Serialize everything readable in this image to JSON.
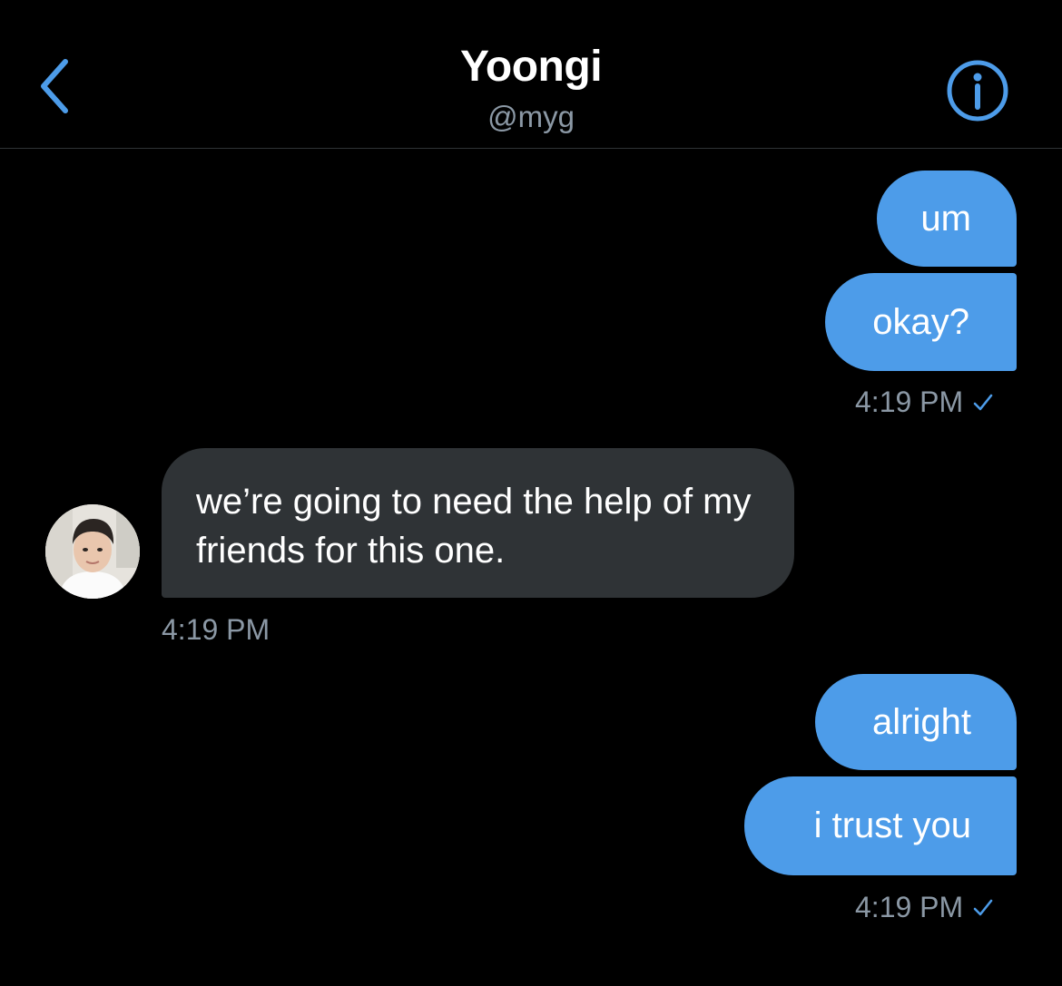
{
  "header": {
    "title": "Yoongi",
    "handle": "@myg",
    "back_icon": "chevron-left-icon",
    "info_icon": "info-circle-icon"
  },
  "colors": {
    "background": "#000000",
    "accent": "#4d9ce9",
    "incoming_bubble": "#2f3336",
    "muted_text": "#8b98a5"
  },
  "messages": [
    {
      "direction": "out",
      "text": "um"
    },
    {
      "direction": "out",
      "text": "okay?"
    },
    {
      "direction": "out_time",
      "time": "4:19 PM",
      "status_icon": "checkmark-icon"
    },
    {
      "direction": "in",
      "text": "we’re going to need the help of my friends for this one."
    },
    {
      "direction": "in_time",
      "time": "4:19 PM"
    },
    {
      "direction": "out",
      "text": "alright"
    },
    {
      "direction": "out",
      "text": "i trust you"
    },
    {
      "direction": "out_time",
      "time": "4:19 PM",
      "status_icon": "checkmark-icon"
    }
  ]
}
